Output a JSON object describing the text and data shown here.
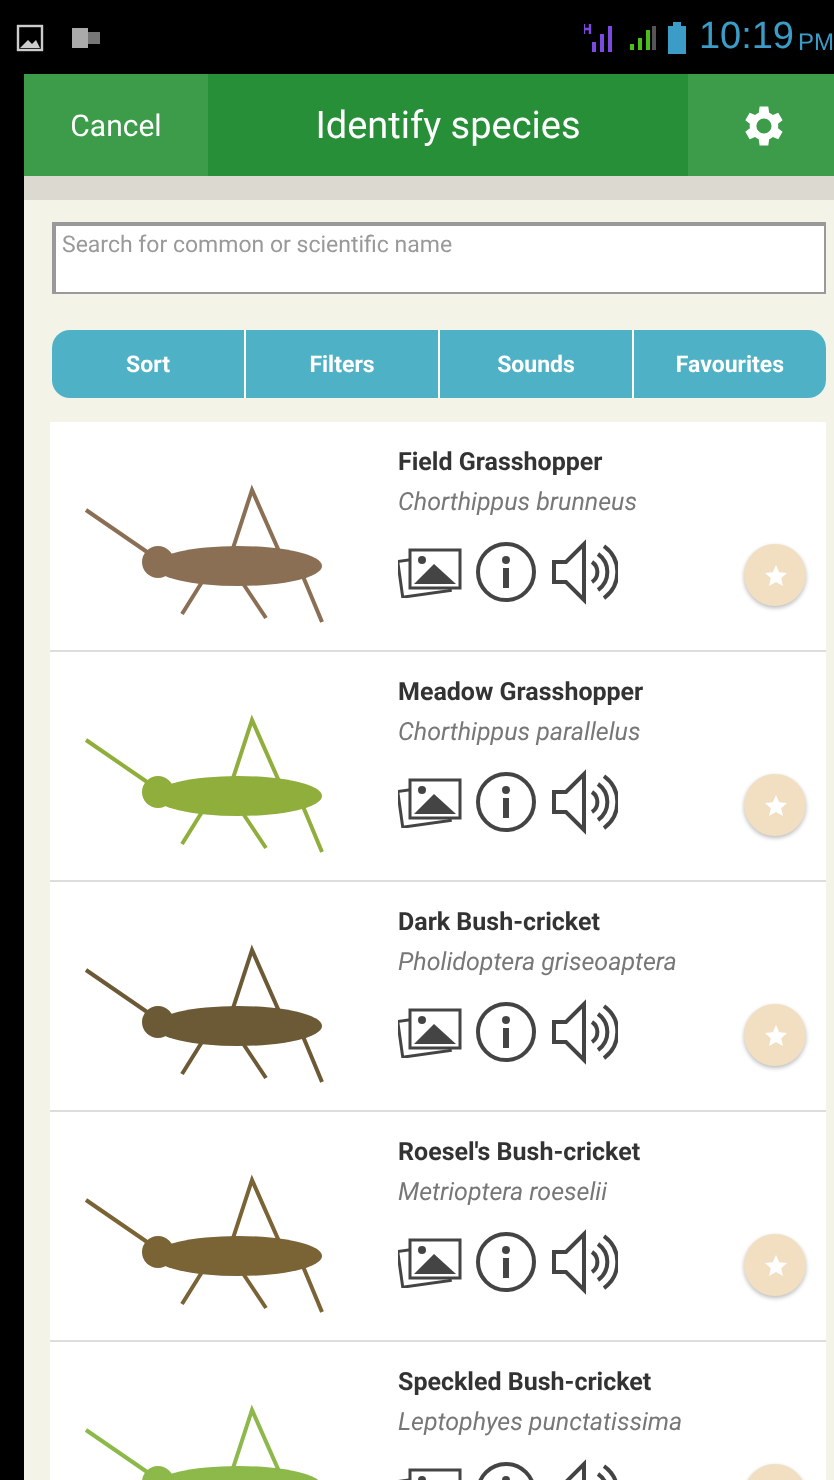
{
  "status_bar": {
    "time": "10:19",
    "period": "PM"
  },
  "header": {
    "cancel": "Cancel",
    "title": "Identify species"
  },
  "search": {
    "placeholder": "Search for common or scientific name"
  },
  "segments": [
    "Sort",
    "Filters",
    "Sounds",
    "Favourites"
  ],
  "species": [
    {
      "name": "Field Grasshopper",
      "latin": "Chorthippus brunneus",
      "color": "#8a6f55"
    },
    {
      "name": "Meadow Grasshopper",
      "latin": "Chorthippus parallelus",
      "color": "#8fae3c"
    },
    {
      "name": "Dark Bush-cricket",
      "latin": "Pholidoptera griseoaptera",
      "color": "#6b5a35"
    },
    {
      "name": "Roesel's Bush-cricket",
      "latin": "Metrioptera roeselii",
      "color": "#7a6335"
    },
    {
      "name": "Speckled Bush-cricket",
      "latin": "Leptophyes punctatissima",
      "color": "#8db84a"
    }
  ]
}
